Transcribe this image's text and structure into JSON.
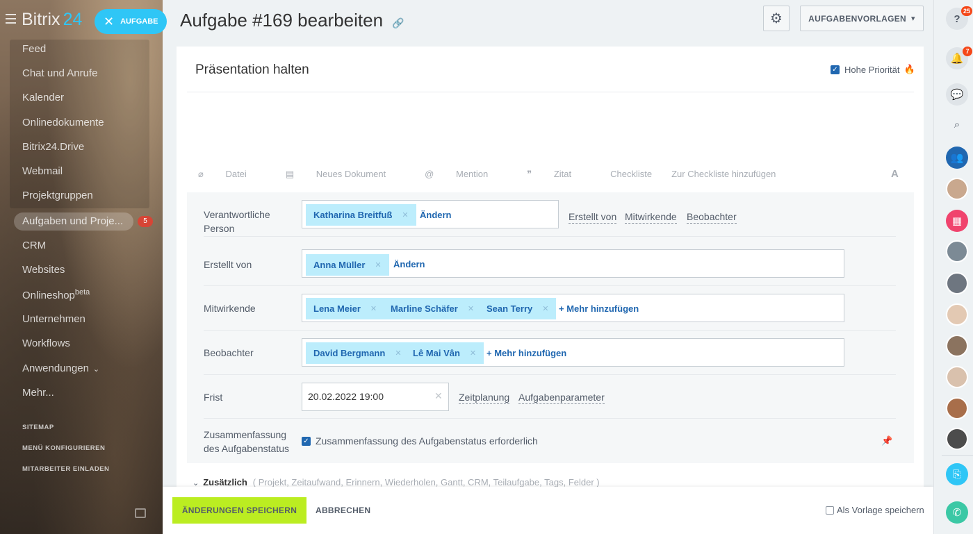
{
  "sidebar": {
    "brand_name": "Bitrix",
    "brand_num": "24",
    "task_button": "AUFGABE",
    "items": [
      {
        "label": "Feed"
      },
      {
        "label": "Chat und Anrufe"
      },
      {
        "label": "Kalender"
      },
      {
        "label": "Onlinedokumente"
      },
      {
        "label": "Bitrix24.Drive"
      },
      {
        "label": "Webmail"
      },
      {
        "label": "Projektgruppen"
      },
      {
        "label": "Aufgaben und Proje..."
      },
      {
        "label": "CRM"
      },
      {
        "label": "Websites"
      },
      {
        "label": "Onlineshop"
      },
      {
        "label": "Unternehmen"
      },
      {
        "label": "Workflows"
      },
      {
        "label": "Anwendungen"
      },
      {
        "label": "Mehr..."
      }
    ],
    "onlineshop_sup": "beta",
    "tasks_badge": "5",
    "links": {
      "sitemap": "SITEMAP",
      "configure": "MENÜ KONFIGURIEREN",
      "invite": "MITARBEITER EINLADEN"
    }
  },
  "header": {
    "title": "Aufgabe #169 bearbeiten",
    "templates_button": "AUFGABENVORLAGEN"
  },
  "task": {
    "name": "Präsentation halten",
    "priority_label": "Hohe Priorität"
  },
  "toolbar": {
    "file": "Datei",
    "new_doc": "Neues Dokument",
    "mention": "Mention",
    "quote": "Zitat",
    "checklist": "Checkliste",
    "add_checklist": "Zur Checkliste hinzufügen",
    "font": "A"
  },
  "form": {
    "responsible": {
      "label": "Verantwortliche Person",
      "person": "Katharina Breitfuß",
      "change": "Ändern",
      "links": [
        "Erstellt von",
        "Mitwirkende",
        "Beobachter"
      ]
    },
    "creator": {
      "label": "Erstellt von",
      "person": "Anna Müller",
      "change": "Ändern"
    },
    "participants": {
      "label": "Mitwirkende",
      "people": [
        "Lena Meier",
        "Marline Schäfer",
        "Sean Terry"
      ],
      "add": "+ Mehr hinzufügen"
    },
    "observers": {
      "label": "Beobachter",
      "people": [
        "David Bergmann",
        "Lê Mai Vân"
      ],
      "add": "+ Mehr hinzufügen"
    },
    "deadline": {
      "label": "Frist",
      "value": "20.02.2022 19:00",
      "planning": "Zeitplanung",
      "params": "Aufgabenparameter"
    },
    "summary": {
      "label": "Zusammenfassung des Aufgabenstatus",
      "check_label": "Zusammenfassung des Aufgabenstatus erforderlich"
    }
  },
  "extra": {
    "title": "Zusätzlich",
    "items": "( Projekt,  Zeitaufwand,  Erinnern,  Wiederholen,  Gantt,  CRM,  Teilaufgabe,  Tags,  Felder )"
  },
  "footer": {
    "save": "ÄNDERUNGEN SPEICHERN",
    "cancel": "ABBRECHEN",
    "save_template": "Als Vorlage speichern"
  },
  "rightbar": {
    "help_badge": "25",
    "notif_badge": "7"
  },
  "colors": {
    "accent": "#2fc6f6",
    "save": "#bbed21",
    "link": "#2067b0",
    "tag": "#bcedfc"
  }
}
